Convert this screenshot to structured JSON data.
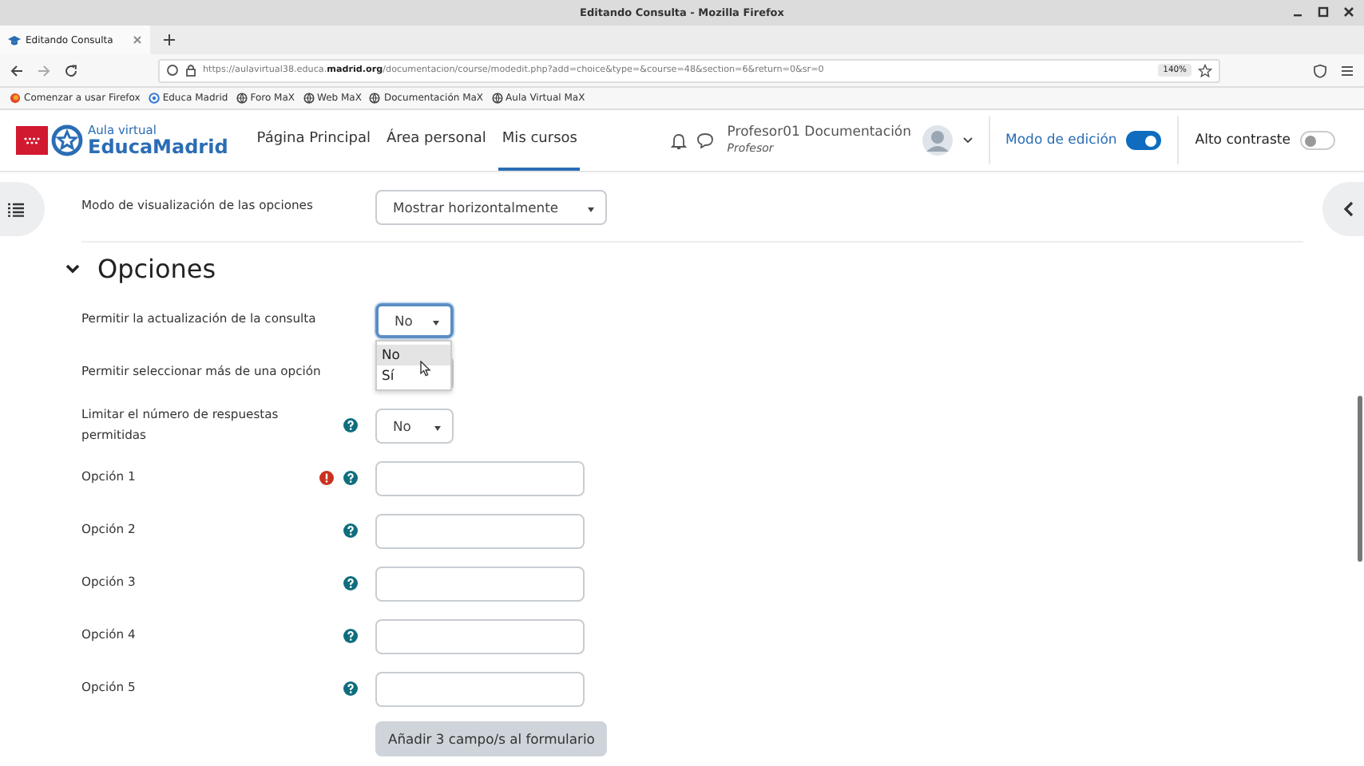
{
  "window": {
    "title": "Editando Consulta - Mozilla Firefox"
  },
  "tabs": [
    {
      "label": "Editando Consulta",
      "selected": true
    }
  ],
  "address_bar": {
    "url": "https://aulavirtual38.educa.**madrid.org**/documentacion/course/modedit.php?add=choice&type=&course=48&section=6&return=0&sr=0",
    "zoom": "140%"
  },
  "bookmarks": [
    {
      "kind": "firefox",
      "label": "Comenzar a usar Firefox"
    },
    {
      "kind": "site",
      "label": "Educa Madrid"
    },
    {
      "kind": "globe",
      "label": "Foro MaX"
    },
    {
      "kind": "globe",
      "label": "Web MaX"
    },
    {
      "kind": "globe",
      "label": "Documentación MaX"
    },
    {
      "kind": "globe",
      "label": "Aula Virtual MaX"
    }
  ],
  "site_header": {
    "logo_top": "Aula virtual",
    "logo_bottom": "EducaMadrid",
    "nav": [
      {
        "label": "Página Principal",
        "selected": false
      },
      {
        "label": "Área personal",
        "selected": false
      },
      {
        "label": "Mis cursos",
        "selected": true
      }
    ],
    "user_name": "Profesor01 Documentación",
    "user_role": "Profesor",
    "edit_mode": {
      "label": "Modo de edición",
      "on": true
    },
    "high_contrast": {
      "label": "Alto contraste",
      "on": false
    }
  },
  "form": {
    "display_mode": {
      "label": "Modo de visualización de las opciones",
      "value": "Mostrar horizontalmente"
    },
    "section": {
      "title": "Opciones",
      "expanded": true
    },
    "fields": [
      {
        "kind": "select",
        "label": "Permitir la actualización de la consulta",
        "value": "No",
        "help": false,
        "error": false,
        "open": true,
        "options": [
          {
            "label": "No",
            "selected": true
          },
          {
            "label": "Sí",
            "selected": false
          }
        ]
      },
      {
        "kind": "select",
        "label": "Permitir seleccionar más de una opción",
        "help": false,
        "error": false,
        "open": false
      },
      {
        "kind": "select",
        "label": "Limitar el número de respuestas permitidas",
        "value": "No",
        "help": true,
        "error": false,
        "open": false
      },
      {
        "kind": "text",
        "label": "Opción 1",
        "help": true,
        "error": true
      },
      {
        "kind": "text",
        "label": "Opción 2",
        "help": true,
        "error": false
      },
      {
        "kind": "text",
        "label": "Opción 3",
        "help": true,
        "error": false
      },
      {
        "kind": "text",
        "label": "Opción 4",
        "help": true,
        "error": false
      },
      {
        "kind": "text",
        "label": "Opción 5",
        "help": true,
        "error": false
      }
    ],
    "add_button": "Añadir 3 campo/s al formulario"
  }
}
